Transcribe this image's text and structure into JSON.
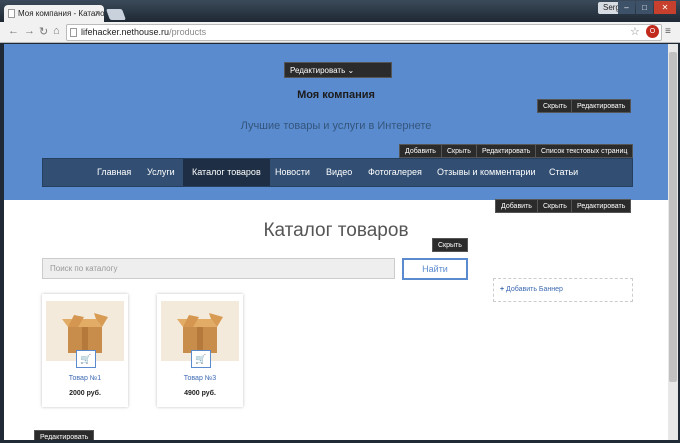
{
  "browser": {
    "tab_title": "Моя компания - Катало",
    "tab_close": "×",
    "user_badge": "Sergey",
    "win_min": "–",
    "win_max": "□",
    "win_close": "✕",
    "url_host": "lifehacker.nethouse.ru",
    "url_path": "/products",
    "ext_badge": "O"
  },
  "hero": {
    "edit_dropdown": "Редактировать ⌄",
    "company_name": "Моя компания",
    "slogan": "Лучшие товары и услуги в Интернете",
    "hide_label": "Скрыть",
    "edit_label": "Редактировать",
    "bar_buttons": [
      "Добавить",
      "Скрыть",
      "Редактировать",
      "Список текстовых страниц"
    ]
  },
  "nav": {
    "items": [
      "Главная",
      "Услуги",
      "Каталог товаров",
      "Новости",
      "Видео",
      "Фотогалерея",
      "Отзывы и комментарии",
      "Статьи"
    ],
    "active_index": 2
  },
  "content_bar": [
    "Добавить",
    "Скрыть",
    "Редактировать"
  ],
  "catalog": {
    "title": "Каталог товаров",
    "hide_label": "Скрыть",
    "search_placeholder": "Поиск по каталогу",
    "search_button": "Найти",
    "banner_label": "Добавить Баннер",
    "products": [
      {
        "name": "Товар №1",
        "price": "2000 руб."
      },
      {
        "name": "Товар №3",
        "price": "4900 руб."
      }
    ]
  },
  "footer": {
    "edit_label": "Редактировать"
  },
  "colors": {
    "hero_bg": "#5b8bcf",
    "nav_bg": "#324f73",
    "accent": "#3d6ab3"
  }
}
